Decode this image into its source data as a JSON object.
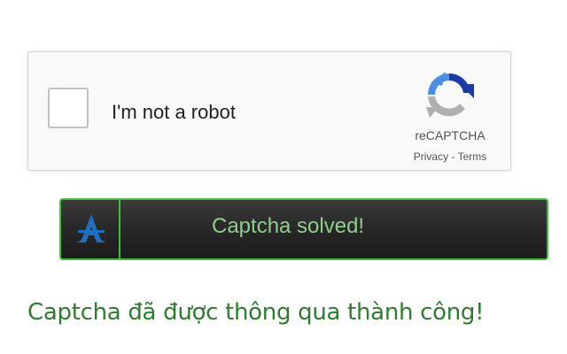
{
  "recaptcha": {
    "checkbox_label": "I'm not a robot",
    "brand": "reCAPTCHA",
    "privacy_link": "Privacy",
    "separator": "-",
    "terms_link": "Terms",
    "logo_icon": "recaptcha-logo-icon",
    "colors": {
      "logo_blue": "#1c3aa9",
      "logo_light_blue": "#4a90e2",
      "logo_gray": "#b0b0b0"
    }
  },
  "solver": {
    "status_text": "Captcha solved!",
    "icon": "solver-logo-icon",
    "colors": {
      "border": "#3fbf3a",
      "text": "#8fce8c",
      "icon": "#1e6fc2"
    }
  },
  "result": {
    "message": "Captcha đã được thông qua thành công!",
    "color": "#2e7d2e"
  }
}
